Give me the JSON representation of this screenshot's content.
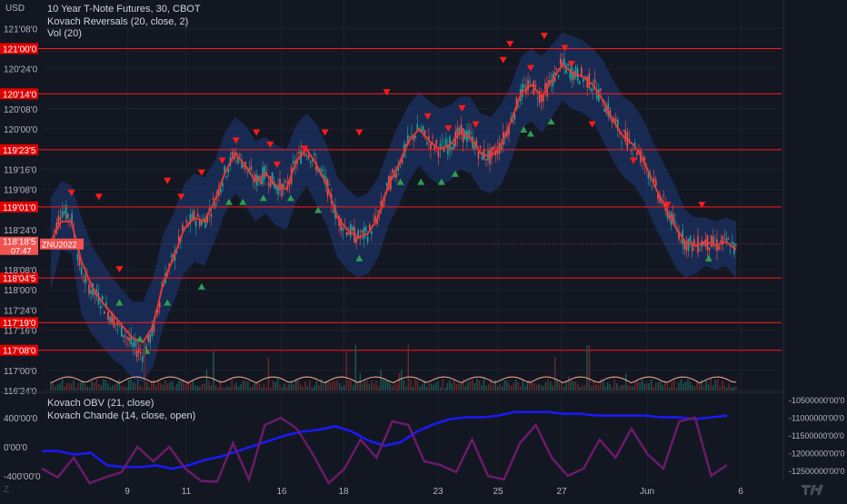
{
  "header": {
    "currency": "USD",
    "title": "10 Year T-Note Futures, 30, CBOT",
    "indicator1": "Kovach Reversals (20, close, 2)",
    "indicator2": "Vol (20)",
    "lower_ind1": "Kovach OBV (21, close)",
    "lower_ind2": "Kovach Chande (14, close, open)"
  },
  "colors": {
    "background": "#131722",
    "grid": "#1e222d",
    "candle_up": "#26a69a",
    "candle_down": "#ef5350",
    "band_fill": "#1e3a7a",
    "mid_line": "#e53935",
    "level_line": "#ff1a1a",
    "obv_line": "#1a1aff",
    "chande_line": "#6a1b6a",
    "volume_ma": "#ffab91"
  },
  "chart_data": [
    {
      "type": "candlestick",
      "title": "10 Year T-Note Futures, 30, CBOT",
      "ylabel": "USD",
      "price_axis_ticks": [
        "121'08'0",
        "120'24'0",
        "120'08'0",
        "120'00'0",
        "119'16'0",
        "119'08'0",
        "118'24'0",
        "118'08'0",
        "118'00'0",
        "117'24'0",
        "117'16'0",
        "117'00'0",
        "116'24'0"
      ],
      "x_ticks": [
        "9",
        "11",
        "16",
        "18",
        "23",
        "25",
        "27",
        "Jun",
        "6"
      ],
      "ylim": [
        116.75,
        121.4
      ],
      "grid": true,
      "last_price": {
        "label": "118'18'5",
        "symbol": "ZNU2022",
        "countdown": "07:47"
      },
      "horizontal_levels": [
        {
          "label": "121'00'0",
          "value": 121.0
        },
        {
          "label": "120'14'0",
          "value": 120.4375
        },
        {
          "label": "119'23'5",
          "value": 119.742
        },
        {
          "label": "119'01'0",
          "value": 119.031
        },
        {
          "label": "118'04'5",
          "value": 118.148
        },
        {
          "label": "117'19'0",
          "value": 117.594
        },
        {
          "label": "117'08'0",
          "value": 117.25
        }
      ],
      "series": [
        {
          "name": "close",
          "values": [
            118.55,
            119.0,
            118.9,
            118.2,
            118.0,
            117.85,
            117.65,
            117.5,
            117.3,
            117.2,
            117.5,
            118.1,
            118.4,
            118.75,
            118.9,
            118.85,
            119.1,
            119.45,
            119.7,
            119.55,
            119.35,
            119.45,
            119.3,
            119.25,
            119.6,
            119.75,
            119.55,
            119.3,
            118.9,
            118.75,
            118.65,
            118.7,
            118.9,
            119.3,
            119.55,
            119.85,
            120.0,
            119.85,
            119.75,
            119.8,
            119.95,
            119.9,
            119.7,
            119.65,
            119.8,
            120.1,
            120.45,
            120.55,
            120.4,
            120.6,
            120.8,
            120.7,
            120.65,
            120.55,
            120.35,
            120.1,
            119.9,
            119.8,
            119.6,
            119.3,
            119.05,
            118.8,
            118.6,
            118.55,
            118.6,
            118.55,
            118.6,
            118.5
          ]
        },
        {
          "name": "upper_band",
          "values": [
            119.15,
            119.35,
            119.3,
            118.9,
            118.55,
            118.35,
            118.15,
            118.0,
            117.85,
            117.85,
            118.15,
            118.7,
            118.95,
            119.3,
            119.45,
            119.4,
            119.6,
            119.95,
            120.15,
            120.05,
            119.85,
            119.9,
            119.8,
            119.75,
            120.05,
            120.2,
            120.05,
            119.8,
            119.4,
            119.25,
            119.15,
            119.2,
            119.4,
            119.75,
            120.05,
            120.3,
            120.45,
            120.35,
            120.25,
            120.3,
            120.4,
            120.4,
            120.2,
            120.15,
            120.3,
            120.55,
            120.9,
            121.0,
            120.9,
            121.05,
            121.2,
            121.15,
            121.1,
            121.0,
            120.85,
            120.6,
            120.4,
            120.3,
            120.1,
            119.8,
            119.55,
            119.3,
            119.0,
            118.9,
            118.9,
            118.85,
            118.9,
            118.85
          ]
        },
        {
          "name": "lower_band",
          "values": [
            118.0,
            118.5,
            118.45,
            117.7,
            117.45,
            117.3,
            117.15,
            117.05,
            116.9,
            116.85,
            117.05,
            117.55,
            117.85,
            118.2,
            118.35,
            118.3,
            118.6,
            118.95,
            119.2,
            119.05,
            118.85,
            118.95,
            118.8,
            118.75,
            119.1,
            119.3,
            119.05,
            118.8,
            118.4,
            118.25,
            118.15,
            118.2,
            118.4,
            118.8,
            119.05,
            119.35,
            119.55,
            119.4,
            119.3,
            119.35,
            119.5,
            119.45,
            119.25,
            119.2,
            119.3,
            119.6,
            120.0,
            120.1,
            119.95,
            120.15,
            120.35,
            120.25,
            120.2,
            120.1,
            119.85,
            119.6,
            119.4,
            119.3,
            119.1,
            118.8,
            118.55,
            118.3,
            118.15,
            118.2,
            118.3,
            118.25,
            118.3,
            118.15
          ]
        },
        {
          "name": "mid_line",
          "values": [
            118.6,
            118.85,
            118.85,
            118.35,
            118.05,
            117.85,
            117.7,
            117.55,
            117.4,
            117.35,
            117.55,
            118.1,
            118.4,
            118.75,
            118.9,
            118.85,
            119.1,
            119.45,
            119.7,
            119.55,
            119.35,
            119.45,
            119.3,
            119.25,
            119.6,
            119.75,
            119.55,
            119.3,
            118.9,
            118.75,
            118.65,
            118.7,
            118.9,
            119.3,
            119.55,
            119.85,
            120.0,
            119.85,
            119.75,
            119.8,
            119.95,
            119.9,
            119.7,
            119.65,
            119.8,
            120.1,
            120.45,
            120.55,
            120.4,
            120.6,
            120.8,
            120.7,
            120.65,
            120.55,
            120.35,
            120.1,
            119.9,
            119.8,
            119.6,
            119.3,
            119.05,
            118.8,
            118.6,
            118.55,
            118.6,
            118.55,
            118.6,
            118.5
          ]
        }
      ],
      "reversal_down_markers": [
        [
          0.03,
          119.2
        ],
        [
          0.07,
          119.15
        ],
        [
          0.1,
          118.25
        ],
        [
          0.17,
          119.35
        ],
        [
          0.19,
          119.15
        ],
        [
          0.22,
          119.45
        ],
        [
          0.25,
          119.6
        ],
        [
          0.27,
          119.85
        ],
        [
          0.3,
          119.95
        ],
        [
          0.32,
          119.8
        ],
        [
          0.33,
          119.55
        ],
        [
          0.37,
          119.75
        ],
        [
          0.4,
          119.95
        ],
        [
          0.45,
          119.95
        ],
        [
          0.49,
          120.45
        ],
        [
          0.55,
          120.15
        ],
        [
          0.58,
          120.0
        ],
        [
          0.6,
          120.25
        ],
        [
          0.62,
          120.05
        ],
        [
          0.66,
          120.85
        ],
        [
          0.67,
          121.05
        ],
        [
          0.7,
          120.75
        ],
        [
          0.72,
          121.15
        ],
        [
          0.75,
          121.0
        ],
        [
          0.76,
          120.8
        ],
        [
          0.79,
          120.05
        ],
        [
          0.85,
          119.6
        ],
        [
          0.9,
          119.05
        ],
        [
          0.95,
          119.05
        ]
      ],
      "reversal_up_markers": [
        [
          0.1,
          117.85
        ],
        [
          0.13,
          117.4
        ],
        [
          0.14,
          117.25
        ],
        [
          0.17,
          117.85
        ],
        [
          0.22,
          118.05
        ],
        [
          0.26,
          119.1
        ],
        [
          0.28,
          119.1
        ],
        [
          0.31,
          119.15
        ],
        [
          0.35,
          119.15
        ],
        [
          0.39,
          119.0
        ],
        [
          0.45,
          118.4
        ],
        [
          0.51,
          119.35
        ],
        [
          0.54,
          119.35
        ],
        [
          0.57,
          119.35
        ],
        [
          0.59,
          119.45
        ],
        [
          0.69,
          120.0
        ],
        [
          0.7,
          119.95
        ],
        [
          0.73,
          120.1
        ],
        [
          0.96,
          118.4
        ]
      ],
      "volume_ma_level": 0.35
    },
    {
      "type": "line",
      "right_axis_ticks": [
        "-10500000'00'0",
        "-11000000'00'0",
        "-11500000'00'0",
        "-12000000'00'0",
        "-12500000'00'0"
      ],
      "left_axis_ticks": [
        "400'00'0",
        "0'00'0",
        "-400'00'0"
      ],
      "series": [
        {
          "name": "Kovach OBV (21, close)",
          "values": [
            -11.95,
            -11.95,
            -12.05,
            -12.0,
            -12.35,
            -12.4,
            -12.4,
            -12.35,
            -12.45,
            -12.35,
            -12.2,
            -12.1,
            -11.95,
            -11.8,
            -11.65,
            -11.5,
            -11.4,
            -11.35,
            -11.25,
            -11.4,
            -11.65,
            -11.8,
            -11.7,
            -11.4,
            -11.2,
            -11.05,
            -11.0,
            -11.0,
            -10.95,
            -10.85,
            -10.85,
            -10.85,
            -10.9,
            -10.9,
            -10.95,
            -10.95,
            -10.95,
            -10.95,
            -11.0,
            -11.0,
            -11.05,
            -11.0,
            -10.95
          ]
        },
        {
          "name": "Kovach Chande (14, close, open)",
          "values": [
            -300,
            -420,
            -150,
            -500,
            -420,
            -350,
            0,
            -200,
            0,
            -300,
            -470,
            -480,
            50,
            -450,
            300,
            400,
            250,
            -100,
            -500,
            -300,
            100,
            -150,
            350,
            300,
            -200,
            -250,
            -350,
            100,
            -400,
            -450,
            50,
            300,
            -150,
            -400,
            -300,
            100,
            -150,
            250,
            -100,
            -300,
            350,
            400,
            -400,
            -250
          ]
        }
      ]
    }
  ]
}
